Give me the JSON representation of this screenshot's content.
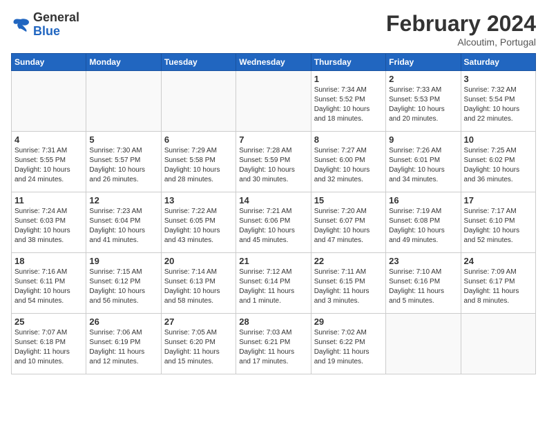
{
  "header": {
    "logo_general": "General",
    "logo_blue": "Blue",
    "month_title": "February 2024",
    "location": "Alcoutim, Portugal"
  },
  "days_of_week": [
    "Sunday",
    "Monday",
    "Tuesday",
    "Wednesday",
    "Thursday",
    "Friday",
    "Saturday"
  ],
  "weeks": [
    [
      {
        "day": "",
        "info": ""
      },
      {
        "day": "",
        "info": ""
      },
      {
        "day": "",
        "info": ""
      },
      {
        "day": "",
        "info": ""
      },
      {
        "day": "1",
        "info": "Sunrise: 7:34 AM\nSunset: 5:52 PM\nDaylight: 10 hours\nand 18 minutes."
      },
      {
        "day": "2",
        "info": "Sunrise: 7:33 AM\nSunset: 5:53 PM\nDaylight: 10 hours\nand 20 minutes."
      },
      {
        "day": "3",
        "info": "Sunrise: 7:32 AM\nSunset: 5:54 PM\nDaylight: 10 hours\nand 22 minutes."
      }
    ],
    [
      {
        "day": "4",
        "info": "Sunrise: 7:31 AM\nSunset: 5:55 PM\nDaylight: 10 hours\nand 24 minutes."
      },
      {
        "day": "5",
        "info": "Sunrise: 7:30 AM\nSunset: 5:57 PM\nDaylight: 10 hours\nand 26 minutes."
      },
      {
        "day": "6",
        "info": "Sunrise: 7:29 AM\nSunset: 5:58 PM\nDaylight: 10 hours\nand 28 minutes."
      },
      {
        "day": "7",
        "info": "Sunrise: 7:28 AM\nSunset: 5:59 PM\nDaylight: 10 hours\nand 30 minutes."
      },
      {
        "day": "8",
        "info": "Sunrise: 7:27 AM\nSunset: 6:00 PM\nDaylight: 10 hours\nand 32 minutes."
      },
      {
        "day": "9",
        "info": "Sunrise: 7:26 AM\nSunset: 6:01 PM\nDaylight: 10 hours\nand 34 minutes."
      },
      {
        "day": "10",
        "info": "Sunrise: 7:25 AM\nSunset: 6:02 PM\nDaylight: 10 hours\nand 36 minutes."
      }
    ],
    [
      {
        "day": "11",
        "info": "Sunrise: 7:24 AM\nSunset: 6:03 PM\nDaylight: 10 hours\nand 38 minutes."
      },
      {
        "day": "12",
        "info": "Sunrise: 7:23 AM\nSunset: 6:04 PM\nDaylight: 10 hours\nand 41 minutes."
      },
      {
        "day": "13",
        "info": "Sunrise: 7:22 AM\nSunset: 6:05 PM\nDaylight: 10 hours\nand 43 minutes."
      },
      {
        "day": "14",
        "info": "Sunrise: 7:21 AM\nSunset: 6:06 PM\nDaylight: 10 hours\nand 45 minutes."
      },
      {
        "day": "15",
        "info": "Sunrise: 7:20 AM\nSunset: 6:07 PM\nDaylight: 10 hours\nand 47 minutes."
      },
      {
        "day": "16",
        "info": "Sunrise: 7:19 AM\nSunset: 6:08 PM\nDaylight: 10 hours\nand 49 minutes."
      },
      {
        "day": "17",
        "info": "Sunrise: 7:17 AM\nSunset: 6:10 PM\nDaylight: 10 hours\nand 52 minutes."
      }
    ],
    [
      {
        "day": "18",
        "info": "Sunrise: 7:16 AM\nSunset: 6:11 PM\nDaylight: 10 hours\nand 54 minutes."
      },
      {
        "day": "19",
        "info": "Sunrise: 7:15 AM\nSunset: 6:12 PM\nDaylight: 10 hours\nand 56 minutes."
      },
      {
        "day": "20",
        "info": "Sunrise: 7:14 AM\nSunset: 6:13 PM\nDaylight: 10 hours\nand 58 minutes."
      },
      {
        "day": "21",
        "info": "Sunrise: 7:12 AM\nSunset: 6:14 PM\nDaylight: 11 hours\nand 1 minute."
      },
      {
        "day": "22",
        "info": "Sunrise: 7:11 AM\nSunset: 6:15 PM\nDaylight: 11 hours\nand 3 minutes."
      },
      {
        "day": "23",
        "info": "Sunrise: 7:10 AM\nSunset: 6:16 PM\nDaylight: 11 hours\nand 5 minutes."
      },
      {
        "day": "24",
        "info": "Sunrise: 7:09 AM\nSunset: 6:17 PM\nDaylight: 11 hours\nand 8 minutes."
      }
    ],
    [
      {
        "day": "25",
        "info": "Sunrise: 7:07 AM\nSunset: 6:18 PM\nDaylight: 11 hours\nand 10 minutes."
      },
      {
        "day": "26",
        "info": "Sunrise: 7:06 AM\nSunset: 6:19 PM\nDaylight: 11 hours\nand 12 minutes."
      },
      {
        "day": "27",
        "info": "Sunrise: 7:05 AM\nSunset: 6:20 PM\nDaylight: 11 hours\nand 15 minutes."
      },
      {
        "day": "28",
        "info": "Sunrise: 7:03 AM\nSunset: 6:21 PM\nDaylight: 11 hours\nand 17 minutes."
      },
      {
        "day": "29",
        "info": "Sunrise: 7:02 AM\nSunset: 6:22 PM\nDaylight: 11 hours\nand 19 minutes."
      },
      {
        "day": "",
        "info": ""
      },
      {
        "day": "",
        "info": ""
      }
    ]
  ]
}
